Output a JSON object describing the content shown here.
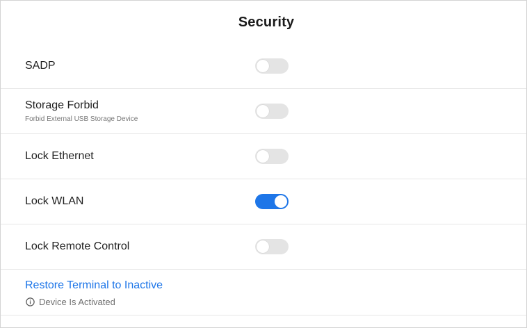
{
  "header": {
    "title": "Security"
  },
  "rows": [
    {
      "label": "SADP",
      "sublabel": "",
      "enabled": false
    },
    {
      "label": "Storage Forbid",
      "sublabel": "Forbid External USB Storage Device",
      "enabled": false
    },
    {
      "label": "Lock Ethernet",
      "sublabel": "",
      "enabled": false
    },
    {
      "label": "Lock WLAN",
      "sublabel": "",
      "enabled": true
    },
    {
      "label": "Lock Remote Control",
      "sublabel": "",
      "enabled": false
    }
  ],
  "restore": {
    "link_label": "Restore Terminal to Inactive",
    "status_text": "Device Is Activated",
    "status_icon": "info-icon"
  },
  "colors": {
    "accent": "#1e76e8",
    "toggle_off": "#e4e4e4"
  }
}
